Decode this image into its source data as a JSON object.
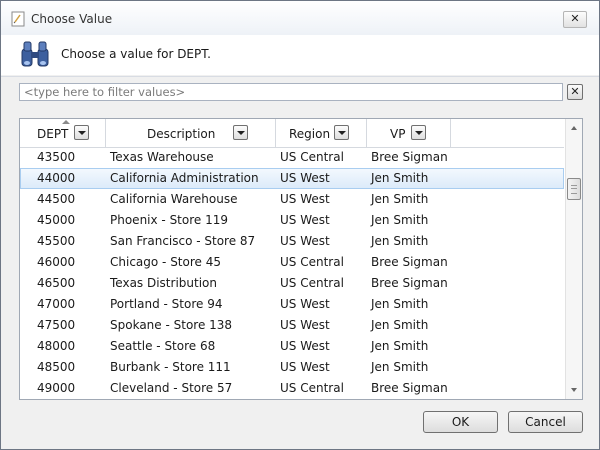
{
  "window": {
    "title": "Choose Value",
    "close_label": "✕"
  },
  "header": {
    "prompt": "Choose a value for DEPT."
  },
  "filter": {
    "placeholder": "<type here to filter values>",
    "value": "",
    "clear_label": "✕"
  },
  "grid": {
    "columns": [
      "DEPT",
      "Description",
      "Region",
      "VP"
    ],
    "selected_index": 1,
    "rows": [
      [
        "43500",
        "Texas Warehouse",
        "US Central",
        "Bree Sigman"
      ],
      [
        "44000",
        "California Administration",
        "US West",
        "Jen Smith"
      ],
      [
        "44500",
        "California Warehouse",
        "US West",
        "Jen Smith"
      ],
      [
        "45000",
        "Phoenix - Store 119",
        "US West",
        "Jen Smith"
      ],
      [
        "45500",
        "San Francisco - Store 87",
        "US West",
        "Jen Smith"
      ],
      [
        "46000",
        "Chicago - Store 45",
        "US Central",
        "Bree Sigman"
      ],
      [
        "46500",
        "Texas Distribution",
        "US Central",
        "Bree Sigman"
      ],
      [
        "47000",
        "Portland - Store 94",
        "US West",
        "Jen Smith"
      ],
      [
        "47500",
        "Spokane - Store 138",
        "US West",
        "Jen Smith"
      ],
      [
        "48000",
        "Seattle - Store 68",
        "US West",
        "Jen Smith"
      ],
      [
        "48500",
        "Burbank - Store 111",
        "US West",
        "Jen Smith"
      ],
      [
        "49000",
        "Cleveland - Store 57",
        "US Central",
        "Bree Sigman"
      ]
    ]
  },
  "buttons": {
    "ok": "OK",
    "cancel": "Cancel"
  },
  "icons": {
    "title": "dialog-icon",
    "header": "binoculars-icon"
  }
}
